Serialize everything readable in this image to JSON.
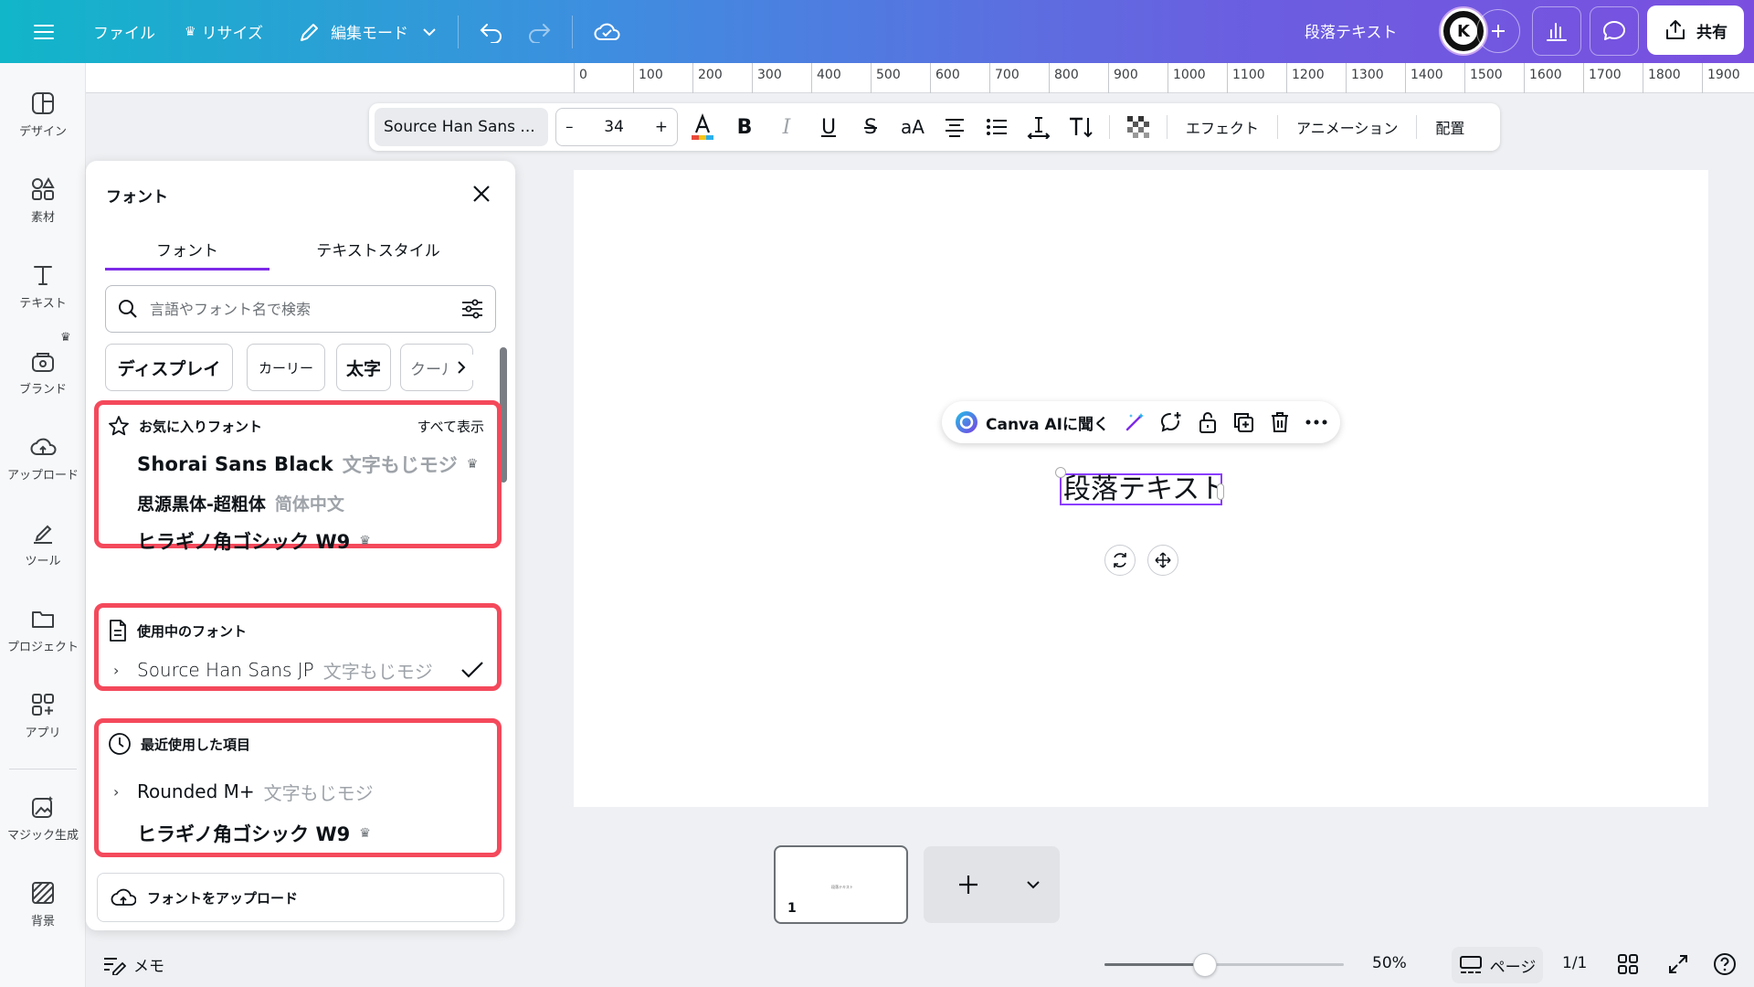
{
  "topbar": {
    "file": "ファイル",
    "resize": "リサイズ",
    "edit_mode": "編集モード",
    "doc_title": "段落テキスト",
    "share": "共有"
  },
  "rail": {
    "items": [
      {
        "label": "デザイン",
        "icon": "layout-icon"
      },
      {
        "label": "素材",
        "icon": "elements-icon"
      },
      {
        "label": "テキスト",
        "icon": "text-icon"
      },
      {
        "label": "ブランド",
        "icon": "brand-icon"
      },
      {
        "label": "アップロード",
        "icon": "upload-cloud-icon"
      },
      {
        "label": "ツール",
        "icon": "draw-tool-icon"
      },
      {
        "label": "プロジェクト",
        "icon": "folder-icon"
      },
      {
        "label": "アプリ",
        "icon": "apps-icon"
      },
      {
        "label": "マジック生成",
        "icon": "magic-media-icon"
      },
      {
        "label": "背景",
        "icon": "background-icon"
      }
    ]
  },
  "ruler": {
    "marks": [
      "0",
      "100",
      "200",
      "300",
      "400",
      "500",
      "600",
      "700",
      "800",
      "900",
      "1000",
      "1100",
      "1200",
      "1300",
      "1400",
      "1500",
      "1600",
      "1700",
      "1800",
      "1900"
    ]
  },
  "text_toolbar": {
    "font_name": "Source Han Sans ...",
    "font_size": "34",
    "minus": "–",
    "plus": "+",
    "effects": "エフェクト",
    "animation": "アニメーション",
    "position": "配置"
  },
  "canvas": {
    "ask_ai": "Canva AIに聞く",
    "selected_text": "段落テキスト"
  },
  "font_panel": {
    "title": "フォント",
    "tabs": [
      "フォント",
      "テキストスタイル"
    ],
    "search_placeholder": "言語やフォント名で検索",
    "chips": [
      "ディスプレイ",
      "カーリー",
      "太字",
      "クール"
    ],
    "favorites": {
      "title": "お気に入りフォント",
      "view_all": "すべて表示",
      "fonts": [
        {
          "name": "Shorai Sans Black",
          "sample": "文字もじモジ",
          "premium": true
        },
        {
          "name": "思源黒体-超粗体",
          "sample": "简体中文",
          "premium": false
        },
        {
          "name": "ヒラギノ角ゴシック W9",
          "sample": "",
          "premium": true
        }
      ]
    },
    "in_use": {
      "title": "使用中のフォント",
      "fonts": [
        {
          "name": "Source Han Sans JP",
          "sample": "文字もじモジ",
          "selected": true
        }
      ]
    },
    "recent": {
      "title": "最近使用した項目",
      "fonts": [
        {
          "name": "Rounded M+",
          "sample": "文字もじモジ",
          "premium": false
        },
        {
          "name": "ヒラギノ角ゴシック W9",
          "sample": "",
          "premium": true
        }
      ]
    },
    "upload": "フォントをアップロード"
  },
  "pages": {
    "thumb_number": "1",
    "thumb_text": "段落テキスト"
  },
  "bottombar": {
    "notes": "メモ",
    "zoom": "50%",
    "zoom_level": 0.42,
    "pages": "ページ",
    "page_count": "1/1"
  },
  "colors": {
    "accent": "#7d2ae8",
    "highlight": "#f4495b",
    "selection": "#8b3dff"
  }
}
